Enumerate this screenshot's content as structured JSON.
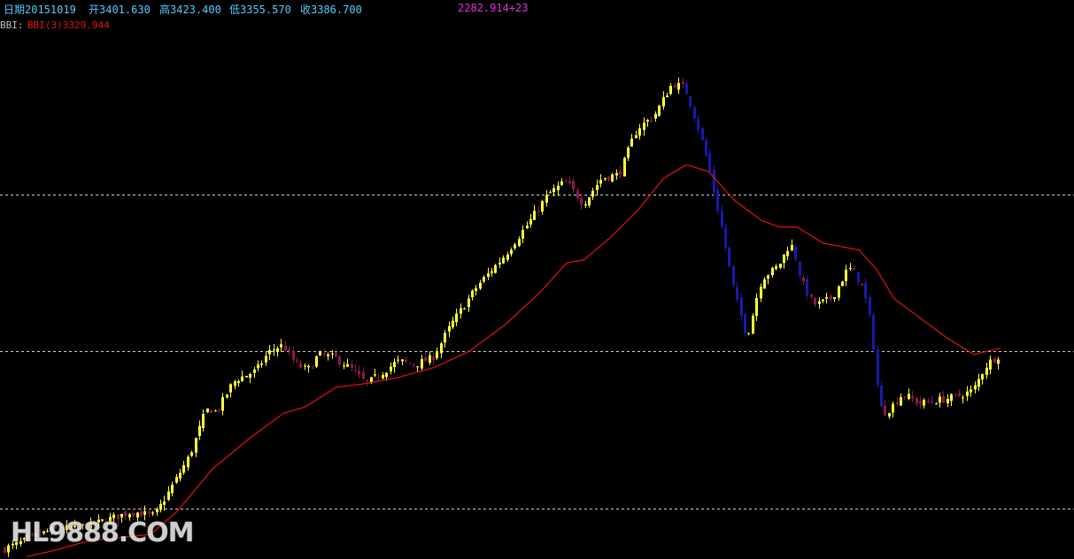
{
  "header": {
    "date_label": "日期20151019",
    "open_label": "开3401.630",
    "high_label": "高3423.400",
    "low_label": "低3355.570",
    "close_label": "收3386.700",
    "right_value": "2282.914+23"
  },
  "indicator": {
    "name": "BBI:",
    "formula_label": "BBI(3)3329.944"
  },
  "watermark": "HL9888.COM",
  "colors": {
    "background": "#000000",
    "bullish": "#ffff33",
    "bearish": "#8b1a4a",
    "down_strong": "#1a1aaa",
    "bbi_line": "#e31414",
    "grid": "#cfcfcf",
    "header_text": "#55ccff",
    "right_value": "#dd33dd",
    "indicator_name": "#c0c0c0",
    "indicator_value": "#e31414"
  },
  "chart_data": {
    "type": "candlestick",
    "price_min": 1850,
    "price_max": 3500,
    "gridlines": [
      2960,
      2480,
      2000
    ],
    "series_hint": "close path used to generate candles",
    "close_path": [
      [
        0,
        1870
      ],
      [
        20,
        1890
      ],
      [
        60,
        1935
      ],
      [
        100,
        1945
      ],
      [
        150,
        1990
      ],
      [
        175,
        1975
      ],
      [
        185,
        2020
      ],
      [
        215,
        2160
      ],
      [
        235,
        2310
      ],
      [
        245,
        2290
      ],
      [
        265,
        2390
      ],
      [
        290,
        2420
      ],
      [
        305,
        2480
      ],
      [
        320,
        2500
      ],
      [
        335,
        2440
      ],
      [
        350,
        2420
      ],
      [
        360,
        2470
      ],
      [
        380,
        2460
      ],
      [
        400,
        2420
      ],
      [
        415,
        2380
      ],
      [
        430,
        2410
      ],
      [
        450,
        2450
      ],
      [
        470,
        2440
      ],
      [
        490,
        2460
      ],
      [
        510,
        2560
      ],
      [
        540,
        2680
      ],
      [
        570,
        2770
      ],
      [
        600,
        2880
      ],
      [
        620,
        2960
      ],
      [
        640,
        3000
      ],
      [
        660,
        2930
      ],
      [
        680,
        3010
      ],
      [
        700,
        3020
      ],
      [
        720,
        3160
      ],
      [
        740,
        3200
      ],
      [
        760,
        3300
      ],
      [
        775,
        3285
      ],
      [
        790,
        3160
      ],
      [
        800,
        3060
      ],
      [
        815,
        2870
      ],
      [
        830,
        2660
      ],
      [
        845,
        2520
      ],
      [
        860,
        2700
      ],
      [
        880,
        2740
      ],
      [
        895,
        2820
      ],
      [
        905,
        2700
      ],
      [
        920,
        2620
      ],
      [
        940,
        2640
      ],
      [
        960,
        2740
      ],
      [
        975,
        2680
      ],
      [
        985,
        2560
      ],
      [
        995,
        2290
      ],
      [
        1005,
        2300
      ],
      [
        1020,
        2350
      ],
      [
        1040,
        2320
      ],
      [
        1060,
        2330
      ],
      [
        1080,
        2340
      ],
      [
        1100,
        2360
      ],
      [
        1115,
        2440
      ],
      [
        1130,
        2470
      ]
    ],
    "bbi_path": [
      [
        30,
        1852
      ],
      [
        60,
        1870
      ],
      [
        100,
        1900
      ],
      [
        170,
        1920
      ],
      [
        200,
        1990
      ],
      [
        240,
        2120
      ],
      [
        280,
        2210
      ],
      [
        320,
        2290
      ],
      [
        345,
        2310
      ],
      [
        380,
        2370
      ],
      [
        410,
        2380
      ],
      [
        450,
        2400
      ],
      [
        490,
        2430
      ],
      [
        530,
        2480
      ],
      [
        570,
        2560
      ],
      [
        610,
        2660
      ],
      [
        640,
        2750
      ],
      [
        660,
        2760
      ],
      [
        690,
        2830
      ],
      [
        720,
        2910
      ],
      [
        750,
        3010
      ],
      [
        775,
        3050
      ],
      [
        800,
        3030
      ],
      [
        830,
        2940
      ],
      [
        860,
        2880
      ],
      [
        880,
        2860
      ],
      [
        900,
        2860
      ],
      [
        930,
        2810
      ],
      [
        970,
        2790
      ],
      [
        990,
        2730
      ],
      [
        1010,
        2640
      ],
      [
        1040,
        2580
      ],
      [
        1070,
        2520
      ],
      [
        1100,
        2470
      ],
      [
        1130,
        2490
      ]
    ]
  }
}
